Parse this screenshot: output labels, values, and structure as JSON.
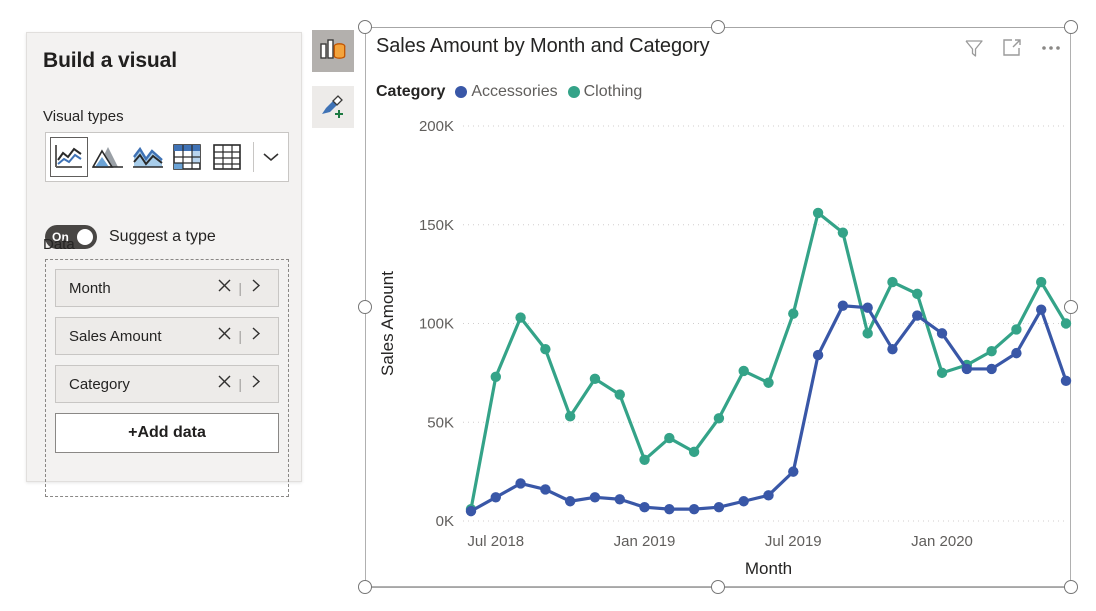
{
  "build_panel": {
    "title": "Build a visual",
    "visual_types_label": "Visual types",
    "visual_type_icons": [
      "line-chart-icon",
      "area-chart-icon",
      "line-and-stacked-column-icon",
      "matrix-table-icon",
      "table-icon"
    ],
    "visual_types_more": "chevron-down-icon",
    "suggest": {
      "toggle_state": "On",
      "label": "Suggest a type"
    },
    "data_label": "Data",
    "fields": [
      {
        "name": "Month",
        "remove": "close-icon",
        "expand": "chevron-right-icon"
      },
      {
        "name": "Sales Amount",
        "remove": "close-icon",
        "expand": "chevron-right-icon"
      },
      {
        "name": "Category",
        "remove": "close-icon",
        "expand": "chevron-right-icon"
      }
    ],
    "add_data_label": "+Add data"
  },
  "mini_toolbar": {
    "build_icon": "build-visual-icon",
    "format_icon": "format-paint-brush-add-icon"
  },
  "visual": {
    "title": "Sales Amount by Month and Category",
    "actions": [
      {
        "name": "filter-icon"
      },
      {
        "name": "focus-mode-icon"
      },
      {
        "name": "more-options-icon",
        "glyph": "···"
      }
    ],
    "legend_title": "Category"
  },
  "colors": {
    "accessories": "#3957a7",
    "clothing": "#34a388",
    "gridline": "#d0cece",
    "axis_text": "#605e5c",
    "title_text": "#252423",
    "panel_bg": "#f3f2f1"
  },
  "chart_data": {
    "type": "line",
    "title": "Sales Amount by Month and Category",
    "xlabel": "Month",
    "ylabel": "Sales Amount",
    "ylim": [
      0,
      200000
    ],
    "ytick_labels": [
      "0K",
      "50K",
      "100K",
      "150K",
      "200K"
    ],
    "ytick_values": [
      0,
      50000,
      100000,
      150000,
      200000
    ],
    "xtick_labels": [
      "Jul 2018",
      "Jan 2019",
      "Jul 2019",
      "Jan 2020"
    ],
    "xtick_indices": [
      1,
      7,
      13,
      19
    ],
    "grid": true,
    "legend_position": "top",
    "legend_title": "Category",
    "x": [
      "Jun 2018",
      "Jul 2018",
      "Aug 2018",
      "Sep 2018",
      "Oct 2018",
      "Nov 2018",
      "Dec 2018",
      "Jan 2019",
      "Feb 2019",
      "Mar 2019",
      "Apr 2019",
      "May 2019",
      "Jun 2019",
      "Jul 2019",
      "Aug 2019",
      "Sep 2019",
      "Oct 2019",
      "Nov 2019",
      "Dec 2019",
      "Jan 2020",
      "Feb 2020",
      "Mar 2020",
      "Apr 2020",
      "May 2020",
      "Jun 2020"
    ],
    "series": [
      {
        "name": "Accessories",
        "color": "#3957a7",
        "values": [
          5000,
          12000,
          19000,
          16000,
          10000,
          12000,
          11000,
          7000,
          6000,
          6000,
          7000,
          10000,
          13000,
          25000,
          84000,
          109000,
          108000,
          87000,
          104000,
          95000,
          77000,
          77000,
          85000,
          107000,
          71000
        ]
      },
      {
        "name": "Clothing",
        "color": "#34a388",
        "values": [
          6000,
          73000,
          103000,
          87000,
          53000,
          72000,
          64000,
          31000,
          42000,
          35000,
          52000,
          76000,
          70000,
          105000,
          156000,
          146000,
          95000,
          121000,
          115000,
          75000,
          79000,
          86000,
          97000,
          121000,
          100000
        ]
      }
    ]
  }
}
